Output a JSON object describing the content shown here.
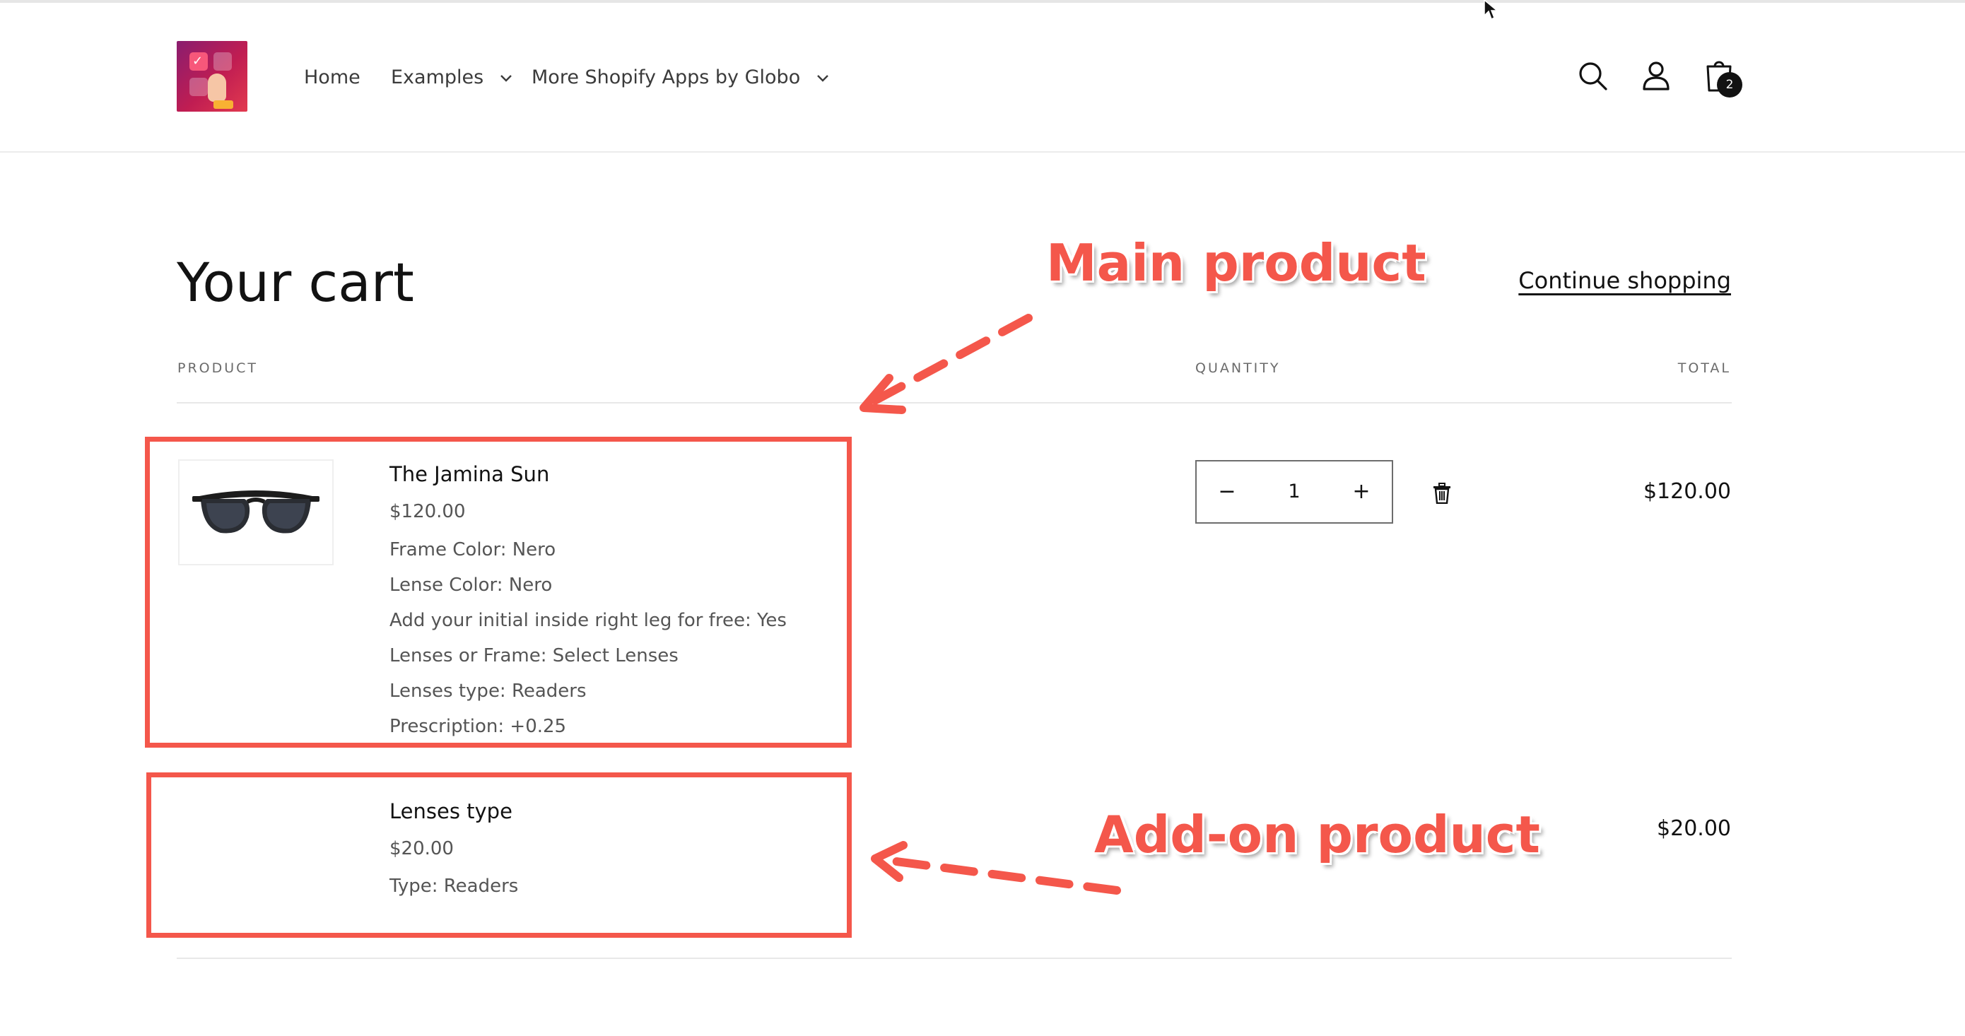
{
  "header": {
    "nav": [
      {
        "label": "Home"
      },
      {
        "label": "Examples"
      },
      {
        "label": "More Shopify Apps by Globo"
      }
    ],
    "cart_count": "2",
    "icons": {
      "search": "search-icon",
      "account": "account-icon",
      "cart": "cart-icon"
    }
  },
  "cart": {
    "title": "Your cart",
    "continue_label": "Continue shopping",
    "columns": {
      "product": "PRODUCT",
      "quantity": "QUANTITY",
      "total": "TOTAL"
    },
    "items": [
      {
        "title": "The Jamina Sun",
        "price": "$120.00",
        "options": [
          "Frame Color: Nero",
          "Lense Color: Nero",
          "Add your initial inside right leg for free: Yes",
          "Lenses or Frame: Select Lenses",
          "Lenses type: Readers",
          "Prescription: +0.25"
        ],
        "quantity": "1",
        "line_total": "$120.00"
      },
      {
        "title": "Lenses type",
        "price": "$20.00",
        "options": [
          "Type: Readers"
        ],
        "line_total": "$20.00"
      }
    ],
    "qty_minus": "−",
    "qty_plus": "+"
  },
  "annotations": {
    "main_label": "Main product",
    "addon_label": "Add-on product",
    "color": "#f4574b"
  }
}
